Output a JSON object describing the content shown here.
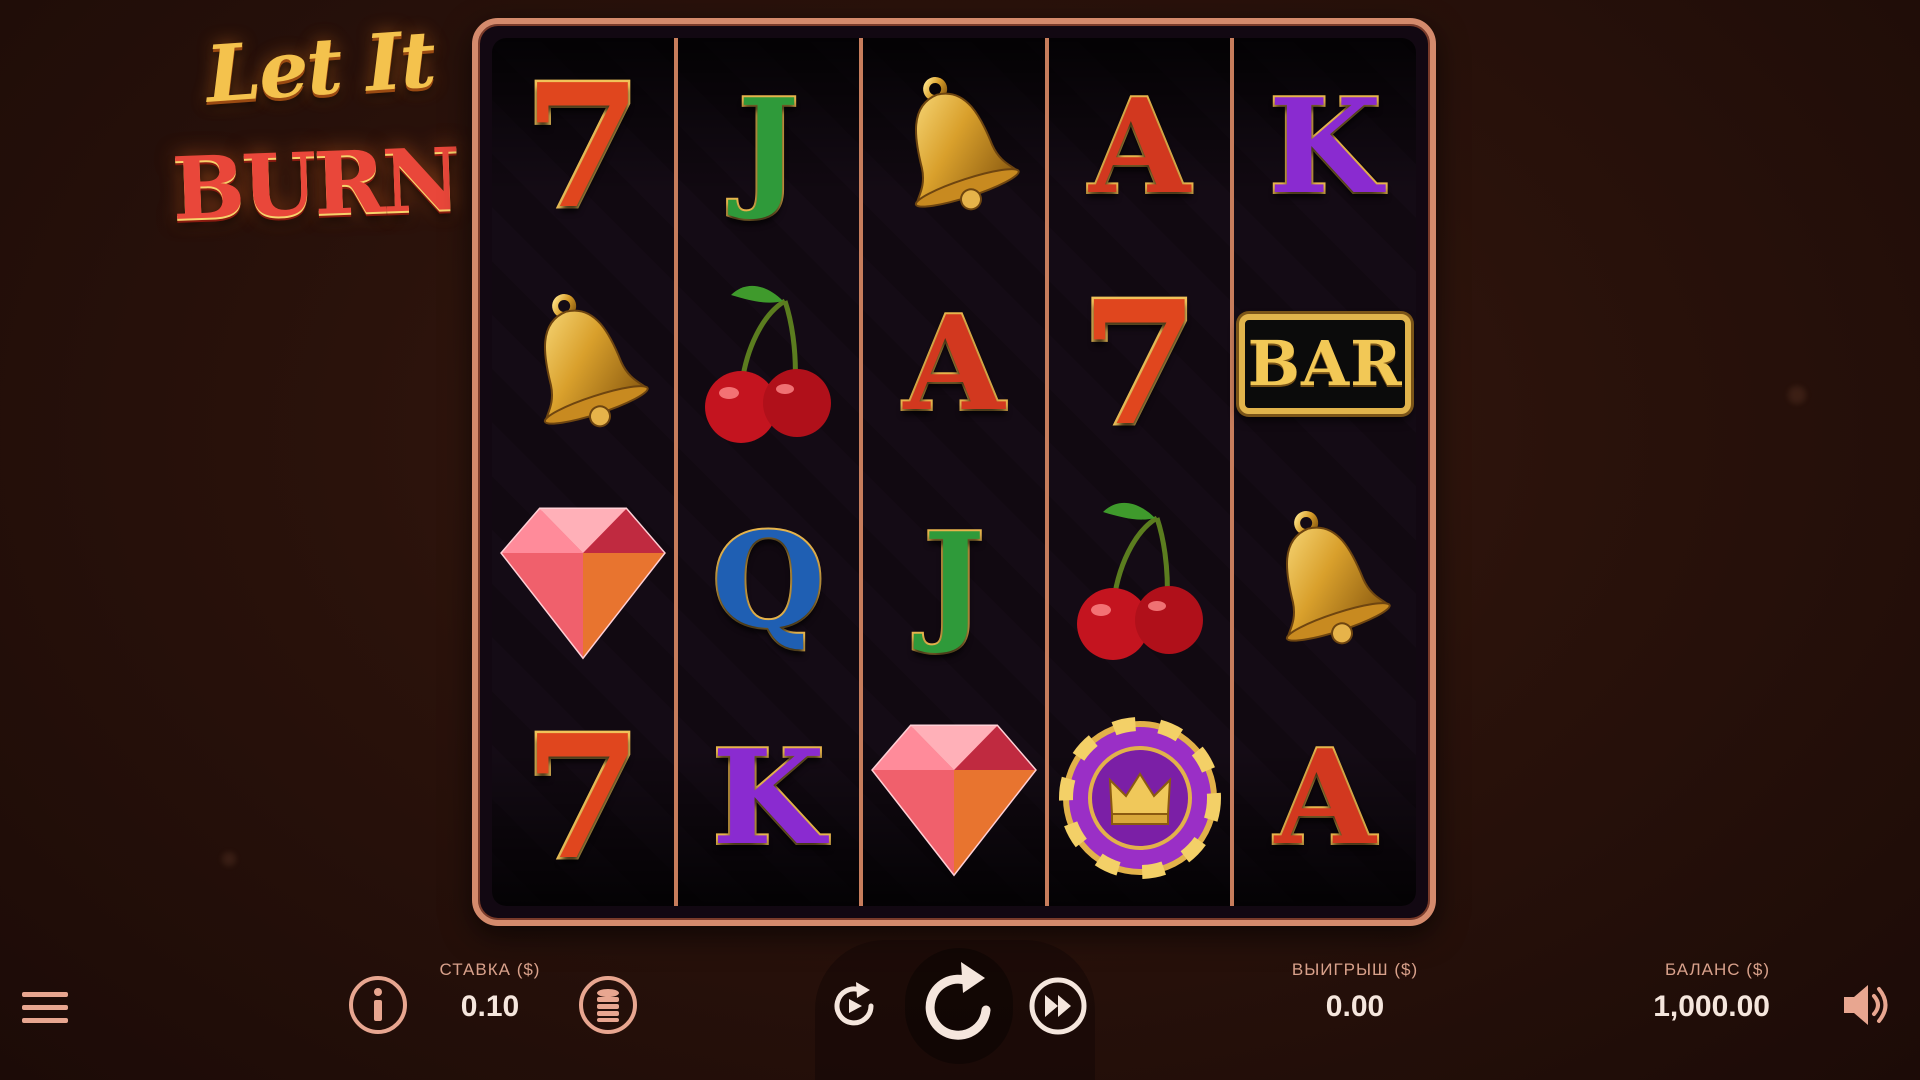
{
  "game": {
    "logo_line1": "Let It",
    "logo_line2": "BURN"
  },
  "reels": [
    [
      "seven",
      "bell",
      "diamond",
      "seven"
    ],
    [
      "J",
      "cherry",
      "Q",
      "K"
    ],
    [
      "bell",
      "A",
      "J",
      "diamond"
    ],
    [
      "A",
      "seven",
      "cherry",
      "chip"
    ],
    [
      "K",
      "BAR",
      "bell",
      "A"
    ]
  ],
  "symbols": {
    "seven_text": "7",
    "bar_text": "BAR",
    "letter_colors": {
      "A": "#d2381f",
      "K": "#8a2bd0",
      "Q": "#1f5fb3",
      "J": "#2f9a3a"
    }
  },
  "bottom_bar": {
    "bet_label": "СТАВКА ($)",
    "bet_value": "0.10",
    "win_label": "ВЫИГРЫШ ($)",
    "win_value": "0.00",
    "balance_label": "БАЛАНС ($)",
    "balance_value": "1,000.00"
  },
  "icons": {
    "menu": "menu-icon",
    "info": "info-icon",
    "coins": "coins-icon",
    "autoplay": "autoplay-icon",
    "spin": "spin-icon",
    "turbo": "turbo-icon",
    "sound": "sound-icon"
  },
  "colors": {
    "frame": "#d48a6c",
    "ui_accent": "#e8a690",
    "text_light": "#f5e6dd"
  }
}
